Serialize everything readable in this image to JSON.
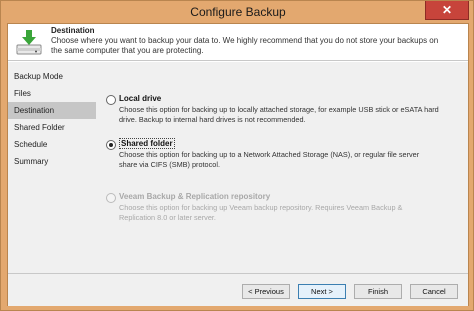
{
  "window": {
    "title": "Configure Backup",
    "close_label": "✕"
  },
  "header": {
    "title": "Destination",
    "description": "Choose where you want to backup your data to. We highly recommend that you do not store your backups on the same computer that you are protecting."
  },
  "sidebar": {
    "items": [
      {
        "label": "Backup Mode"
      },
      {
        "label": "Files"
      },
      {
        "label": "Destination"
      },
      {
        "label": "Shared Folder"
      },
      {
        "label": "Schedule"
      },
      {
        "label": "Summary"
      }
    ]
  },
  "options": [
    {
      "label": "Local drive",
      "description": "Choose this option for backing up to locally attached storage, for example USB stick or eSATA hard drive. Backup to internal hard drives is not recommended."
    },
    {
      "label": "Shared folder",
      "description": "Choose this option for backing up to a Network Attached Storage (NAS), or regular file server share via CIFS (SMB) protocol."
    },
    {
      "label": "Veeam Backup & Replication repository",
      "description": "Choose this option for backing up Veeam backup repository. Requires Veeam Backup & Replication 8.0 or later server."
    }
  ],
  "buttons": {
    "previous": "< Previous",
    "next": "Next >",
    "finish": "Finish",
    "cancel": "Cancel"
  },
  "colors": {
    "frame": "#e3a86f",
    "close": "#c7443b",
    "selected_nav": "#c6c6c6"
  },
  "icons": {
    "header": "download-to-drive-icon"
  }
}
